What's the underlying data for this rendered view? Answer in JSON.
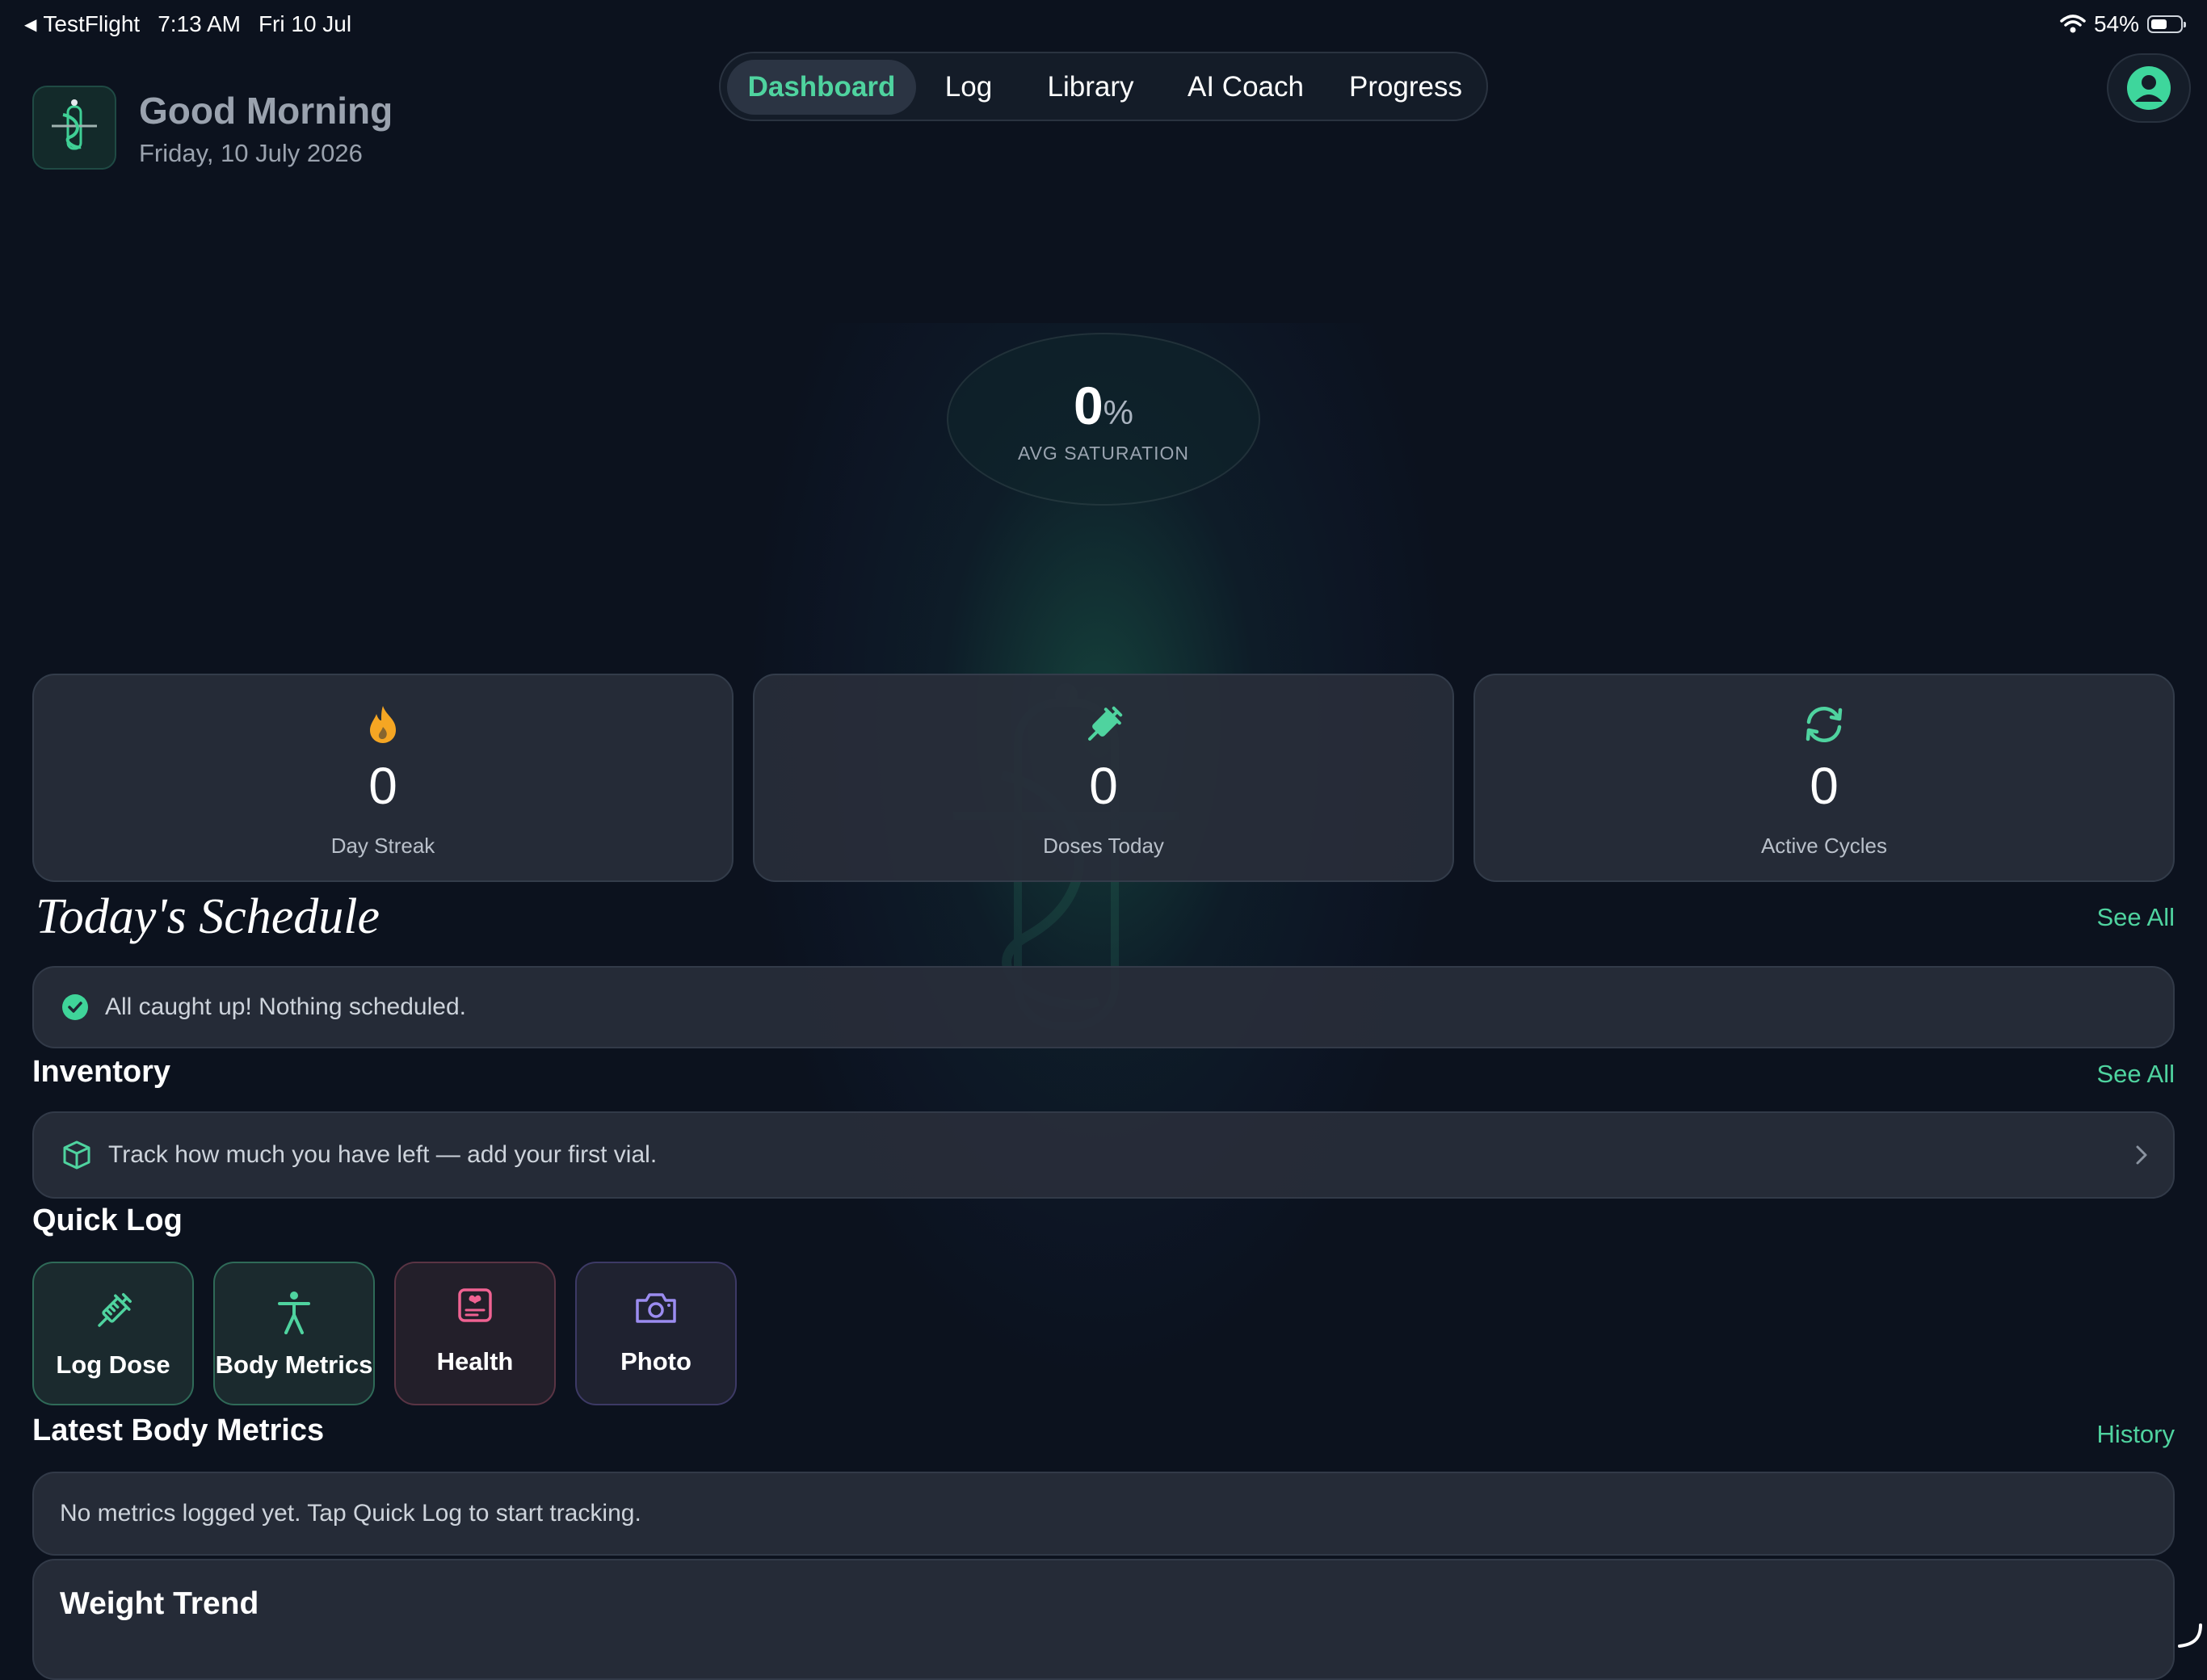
{
  "status_bar": {
    "back_app": "TestFlight",
    "time": "7:13 AM",
    "date": "Fri 10 Jul",
    "battery": "54%"
  },
  "header": {
    "greeting": "Good Morning",
    "date": "Friday, 10 July 2026"
  },
  "nav": {
    "tabs": [
      {
        "label": "Dashboard",
        "active": true
      },
      {
        "label": "Log",
        "active": false
      },
      {
        "label": "Library",
        "active": false
      },
      {
        "label": "AI Coach",
        "active": false
      },
      {
        "label": "Progress",
        "active": false
      }
    ]
  },
  "saturation": {
    "value": "0",
    "unit": "%",
    "label": "AVG SATURATION"
  },
  "stats": [
    {
      "icon": "flame-icon",
      "value": "0",
      "label": "Day Streak",
      "color": "#f5a623"
    },
    {
      "icon": "syringe-icon",
      "value": "0",
      "label": "Doses Today",
      "color": "#4fd39f"
    },
    {
      "icon": "cycle-icon",
      "value": "0",
      "label": "Active Cycles",
      "color": "#4fd39f"
    }
  ],
  "schedule": {
    "title": "Today's Schedule",
    "see_all": "See All",
    "empty_message": "All caught up! Nothing scheduled."
  },
  "inventory": {
    "title": "Inventory",
    "see_all": "See All",
    "prompt": "Track how much you have left — add your first vial."
  },
  "quick_log": {
    "title": "Quick Log",
    "items": [
      {
        "label": "Log Dose",
        "icon": "syringe-icon",
        "color": "#4fd39f"
      },
      {
        "label": "Body Metrics",
        "icon": "person-icon",
        "color": "#4fd39f"
      },
      {
        "label": "Health",
        "icon": "health-card-icon",
        "color": "#f06292"
      },
      {
        "label": "Photo",
        "icon": "camera-icon",
        "color": "#9b8cf0"
      }
    ]
  },
  "body_metrics": {
    "title": "Latest Body Metrics",
    "history_link": "History",
    "empty_message": "No metrics logged yet. Tap Quick Log to start tracking."
  },
  "weight_trend": {
    "title": "Weight Trend"
  },
  "colors": {
    "accent": "#4fd39f",
    "background": "#0c121e",
    "card": "#282e3a",
    "streak": "#f5a623",
    "health": "#f06292",
    "photo": "#9b8cf0"
  }
}
